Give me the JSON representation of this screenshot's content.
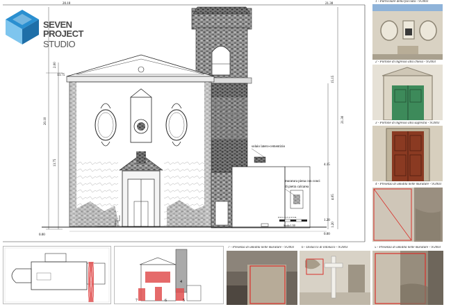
{
  "logo": {
    "line1": "SEVEN",
    "line2": "PROJECT",
    "line3": "STUDIO"
  },
  "elevation": {
    "dims": {
      "top_left": "20.10",
      "top_right": "21.30",
      "left_1": "13.75",
      "left_2": "2.00",
      "left_3": "20.10",
      "left_4": "13.75",
      "base": "0.00",
      "right_1": "15.15",
      "right_2": "21.30",
      "right_3": "4.15",
      "right_4": "4.05",
      "right_5": "1.20",
      "right_6": "1.20",
      "right_7": "0.00"
    },
    "label_solaio": "solaio latero-cementizio",
    "label_muratura_1": "muratura piena con conci",
    "label_muratura_2": "di pietra calcarea",
    "scale_numbers": "0  0.5  1  1.5  2  2.5 m",
    "scale_label": "Scala 1:50"
  },
  "photos": [
    {
      "caption": "1 - Particolare della facciata - 9/2003",
      "subject": "facade-detail"
    },
    {
      "caption": "2 - Portone di ingresso alla chiesa - 9/2003",
      "subject": "church-door"
    },
    {
      "caption": "3 - Portone di ingresso alla sagrestia - 9/2003",
      "subject": "sacristy-door"
    },
    {
      "caption": "4 - Presenza di umidità nelle murature - 9/2003",
      "subject": "damp-wall"
    }
  ],
  "bottom_photos": [
    {
      "caption": "7 - Presenza di umidità nelle murature - 9/2003"
    },
    {
      "caption": "6 - Distacco di intonaco - 9/2003"
    },
    {
      "caption": "5 - Presenza di umidità nelle murature - 9/2003"
    }
  ],
  "mini_elevation_numbers": [
    "7",
    "6",
    "5",
    "4"
  ],
  "colors": {
    "accent_red": "#d9302a",
    "hatch_red": "#e05050",
    "logo_blue": "#3da0d8",
    "door_green": "#3d8a5a",
    "door_brown": "#8a3a22"
  }
}
